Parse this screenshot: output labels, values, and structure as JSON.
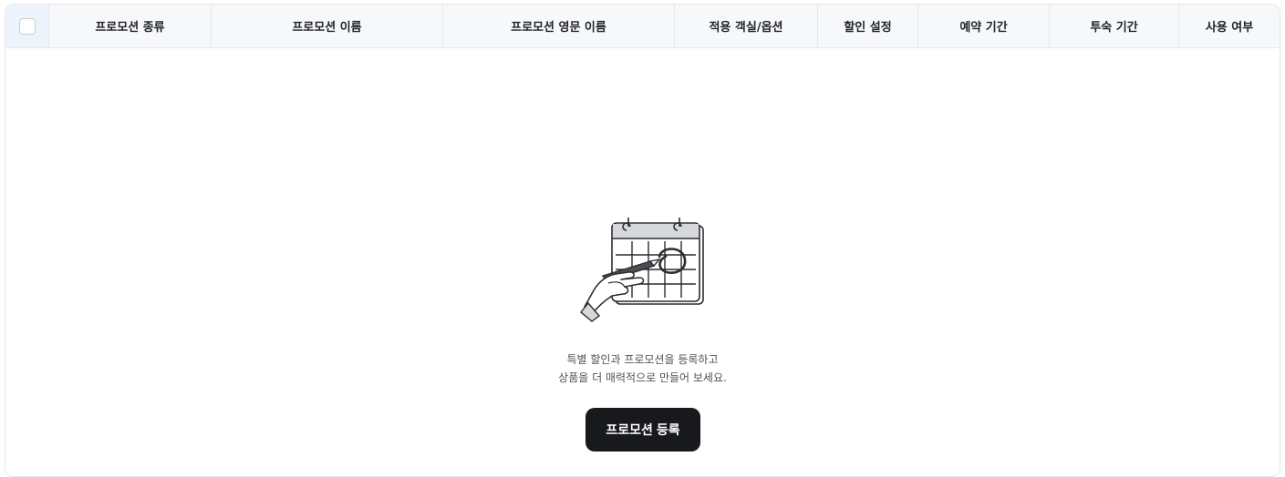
{
  "table": {
    "columns": [
      "프로모션 종류",
      "프로모션 이름",
      "프로모션 영문 이름",
      "적용 객실/옵션",
      "할인 설정",
      "예약 기간",
      "투숙 기간",
      "사용 여부"
    ]
  },
  "empty_state": {
    "icon": "calendar-with-pen-illustration",
    "line1": "특별 할인과 프로모션을 등록하고",
    "line2": "상품을 더 매력적으로 만들어 보세요.",
    "button_label": "프로모션 등록"
  },
  "colors": {
    "header_bg": "#f7f8fa",
    "checkbox_cell_bg": "#eef4fc",
    "border": "#e6e8eb",
    "button_bg": "#17191c",
    "button_text": "#ffffff"
  }
}
